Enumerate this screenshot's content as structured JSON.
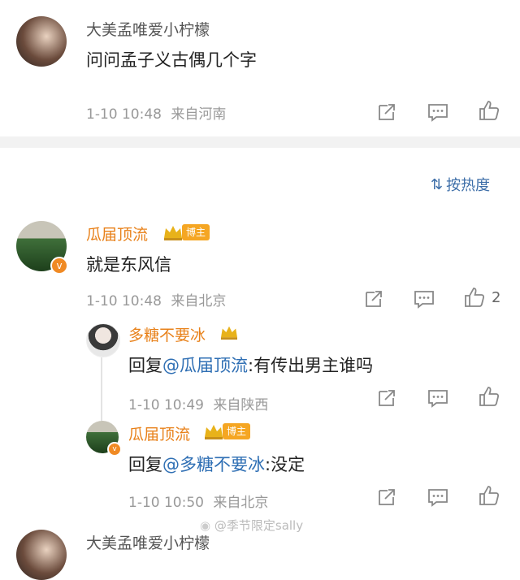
{
  "comment1": {
    "user": "大美孟唯爱小柠檬",
    "text": "问问孟子义古偶几个字",
    "time": "1-10 10:48",
    "source": "来自河南"
  },
  "sort": {
    "label": "按热度"
  },
  "comment2": {
    "user": "瓜届顶流",
    "badge": "博主",
    "text": "就是东风信",
    "time": "1-10 10:48",
    "source": "来自北京",
    "likes": "2"
  },
  "reply1": {
    "user": "多糖不要冰",
    "text_prefix": "回复",
    "mention": "@瓜届顶流",
    "text_suffix": ":有传出男主谁吗",
    "time": "1-10 10:49",
    "source": "来自陕西"
  },
  "reply2": {
    "user": "瓜届顶流",
    "badge": "博主",
    "text_prefix": "回复",
    "mention": "@多糖不要冰",
    "text_suffix": ":没定",
    "time": "1-10 10:50",
    "source": "来自北京"
  },
  "partial": {
    "user": "大美孟唯爱小柠檬"
  },
  "watermark": "@季节限定sally",
  "colors": {
    "accent": "#e8811a",
    "link": "#2f6fb4",
    "badge": "#f5a623"
  }
}
